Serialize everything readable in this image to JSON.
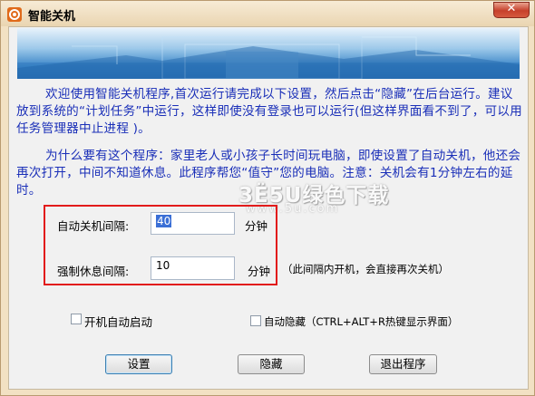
{
  "window": {
    "title": "智能关机",
    "close_glyph": "✕"
  },
  "intro": {
    "paragraph1": "欢迎使用智能关机程序,首次运行请完成以下设置，然后点击“隐藏”在后台运行。建议放到系统的“计划任务”中运行，这样即使没有登录也可以运行(但这样界面看不到了，可以用任务管理器中止进程 )。",
    "paragraph2": "为什么要有这个程序：家里老人或小孩子长时间玩电脑，即使设置了自动关机，他还会再次打开，中间不知道休息。此程序帮您“值守”您的电脑。注意：关机会有1分钟左右的延时。"
  },
  "watermark": {
    "line1": "3Ë5U绿色下载",
    "line2": "www.5u.com"
  },
  "settings": {
    "auto_shutdown_label": "自动关机间隔:",
    "auto_shutdown_value": "40",
    "auto_shutdown_unit": "分钟",
    "forced_rest_label": "强制休息间隔:",
    "forced_rest_value": "10",
    "forced_rest_unit": "分钟",
    "forced_rest_note": "（此间隔内开机，会直接再次关机）"
  },
  "options": {
    "autostart_label": "开机自动启动",
    "autohide_label": "自动隐藏（CTRL+ALT+R热键显示界面）"
  },
  "buttons": {
    "set": "设置",
    "hide": "隐藏",
    "exit": "退出程序"
  },
  "colors": {
    "text_blue": "#1a2fb8",
    "highlight_red": "#e21b1b",
    "window_frame": "#f2e1c3"
  }
}
